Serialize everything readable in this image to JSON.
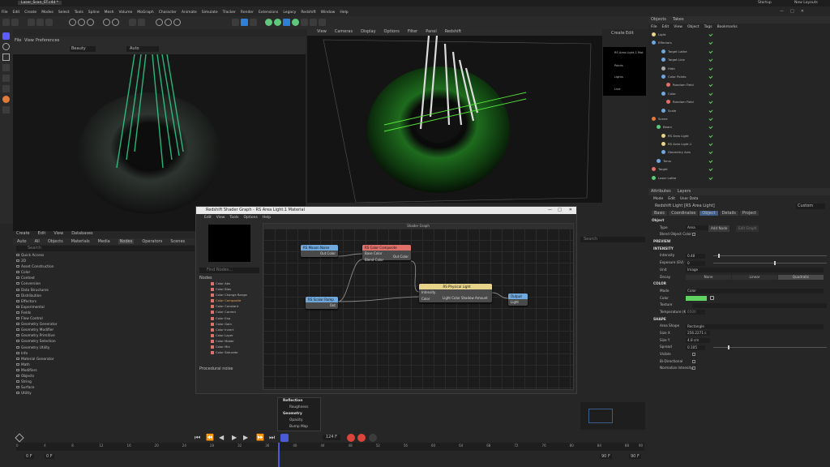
{
  "app": {
    "file_tab": "Laser_Scan_ST.c4d *",
    "account": "Startup",
    "layout_label": "New Layouts",
    "menu": [
      "File",
      "Edit",
      "Create",
      "Modes",
      "Select",
      "Tools",
      "Spline",
      "Mesh",
      "Volume",
      "MoGraph",
      "Character",
      "Animate",
      "Simulate",
      "Tracker",
      "Render",
      "Extensions",
      "Legacy",
      "Redshift",
      "Window",
      "Help"
    ]
  },
  "viewport_left": {
    "menu": [
      "File",
      "View",
      "Preferences"
    ],
    "camera": "Beauty",
    "auto": "Auto"
  },
  "viewport_right": {
    "menu": [
      "View",
      "Cameras",
      "Display",
      "Options",
      "Filter",
      "Panel",
      "Redshift"
    ]
  },
  "attr_side": {
    "tabs": [
      "Create",
      "Edit"
    ],
    "items": [
      "RS Area Light.1 Mat",
      "Points",
      "Lights",
      "Line"
    ]
  },
  "objects": {
    "tabs": [
      "Objects",
      "Takes"
    ],
    "menu": [
      "File",
      "Edit",
      "View",
      "Object",
      "Tags",
      "Bookmarks"
    ],
    "rows": [
      "Light",
      "Effectors",
      "Target Lathe",
      "Target Line",
      "Hide",
      "Color Points",
      "Random Field",
      "Color",
      "Random Field",
      "Scale",
      "Scene",
      "Beam",
      "RS Area Light",
      "RS Area Light.1",
      "Geometry Axis",
      "Torus",
      "Target",
      "Laser Lathe"
    ]
  },
  "asset_browser": {
    "menu": [
      "Create",
      "Edit",
      "View",
      "Databases"
    ],
    "tabs": [
      "Auto",
      "All",
      "Objects",
      "Materials",
      "Media",
      "Nodes",
      "Operators",
      "Scenes",
      "Presets"
    ],
    "search_placeholder": "Search",
    "tree": [
      "Quick Access",
      "2D",
      "Asset Construction",
      "Color",
      "Context",
      "Conversion",
      "Data Structures",
      "Distribution",
      "Effectors",
      "Experimental",
      "Fields",
      "Flow Control",
      "Geometry Generator",
      "Geometry Modifier",
      "Geometry Primitive",
      "Geometry Selection",
      "Geometry Utility",
      "Info",
      "Material Generator",
      "Math",
      "Modifiers",
      "Objects",
      "String",
      "Surface",
      "Utility"
    ]
  },
  "shader_graph": {
    "title": "Redshift Shader Graph - RS Area Light.1 Material",
    "menu": [
      "Edit",
      "View",
      "Tools",
      "Options",
      "Help"
    ],
    "find_placeholder": "Find Nodes...",
    "nodes_label": "Nodes",
    "node_list": [
      "Color Abs",
      "Color Bias",
      "Color Change Range",
      "Color Composite",
      "Color Constant",
      "Color Correct",
      "Color Exp",
      "Color Gain",
      "Color Invert",
      "Color Layer",
      "Color Maker",
      "Color Mix",
      "Color Saturate"
    ],
    "description": "Procedural noise",
    "graph_title": "Shader Graph",
    "search_placeholder": "Search",
    "n_maxon": {
      "title": "RS Maxon Noise",
      "port": "Out Color"
    },
    "n_comp": {
      "title": "RS Color Composite",
      "ports": [
        "Base Color",
        "Blend Color"
      ],
      "out": "Out Color"
    },
    "n_ramp": {
      "title": "RS Scalar Ramp",
      "port": "Out"
    },
    "n_phys": {
      "title": "RS Physical Light",
      "ports": [
        "Intensity",
        "Color"
      ],
      "out": "Light Color Shadow Amount"
    },
    "n_output": {
      "title": "Output",
      "port": "Light"
    }
  },
  "material_popup": {
    "sections": [
      "Reflection",
      "Roughness",
      "Geometry",
      "Opacity",
      "Bump Map"
    ]
  },
  "attributes": {
    "tabs": [
      "Attributes",
      "Layers"
    ],
    "menu": [
      "Mode",
      "Edit",
      "User Data"
    ],
    "object_name": "Redshift Light [RS Area Light]",
    "custom": "Custom",
    "subtabs": [
      "Basic",
      "Coordinates",
      "Object",
      "Details",
      "Project"
    ],
    "object_header": "Object",
    "type_label": "Type",
    "type_value": "Area",
    "add_label": "Add Node",
    "edit_graph": "Edit Graph",
    "blend_label": "Blend Object Color",
    "preview": "PREVIEW",
    "intensity_sec": "INTENSITY",
    "intensity_label": "Intensity",
    "intensity_value": "0.48",
    "exposure_label": "Exposure (EV)",
    "exposure_value": "0",
    "unit_label": "Unit",
    "unit_value": "Image",
    "decay_label": "Decay",
    "decay_opts": [
      "None",
      "Linear",
      "Quadratic"
    ],
    "color_sec": "COLOR",
    "mode_label": "Mode",
    "mode_value": "Color",
    "color_label": "Color",
    "texture_label": "Texture",
    "temperature_label": "Temperature (K)",
    "temperature_value": "6500",
    "shape_sec": "SHAPE",
    "area_shape_label": "Area Shape",
    "area_shape_value": "Rectangle",
    "size_x_label": "Size X",
    "size_x_value": "256.2271 c",
    "size_y_label": "Size Y",
    "size_y_value": "4.8 cm",
    "spread_label": "Spread",
    "spread_value": "0.105",
    "visible_label": "Visible",
    "bidir_label": "Bi-Directional",
    "normalize_label": "Normalize Intensity"
  },
  "timeline": {
    "frame_value": "124 F",
    "start": "0 F",
    "end": "90 F",
    "ticks": [
      "0",
      "4",
      "8",
      "12",
      "16",
      "20",
      "24",
      "28",
      "32",
      "36",
      "40",
      "44",
      "48",
      "52",
      "56",
      "60",
      "64",
      "68",
      "72",
      "76",
      "80",
      "84",
      "88",
      "90"
    ],
    "start2": "0 F",
    "end2": "90 F"
  },
  "colors": {
    "accent": "#2e7fd8",
    "green": "#5fd35f",
    "node_red": "#e0706a",
    "node_blue": "#6fa8dc",
    "node_yellow": "#e7d38a"
  }
}
